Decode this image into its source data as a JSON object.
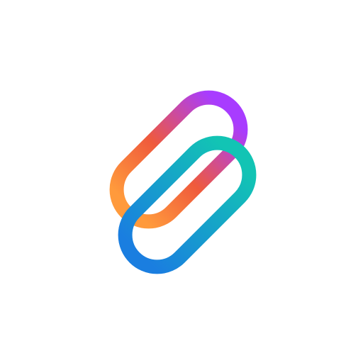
{
  "app": {
    "name": "",
    "background": "#ffffff"
  },
  "logo": {
    "icon": "interlocking-links-icon",
    "back_link": {
      "name": "upper-link",
      "gradient": [
        "#a83cff",
        "#ef5a3c",
        "#ff9a3c"
      ]
    },
    "front_link": {
      "name": "lower-link",
      "gradient": [
        "#12c4b4",
        "#1a7ee0"
      ]
    }
  }
}
